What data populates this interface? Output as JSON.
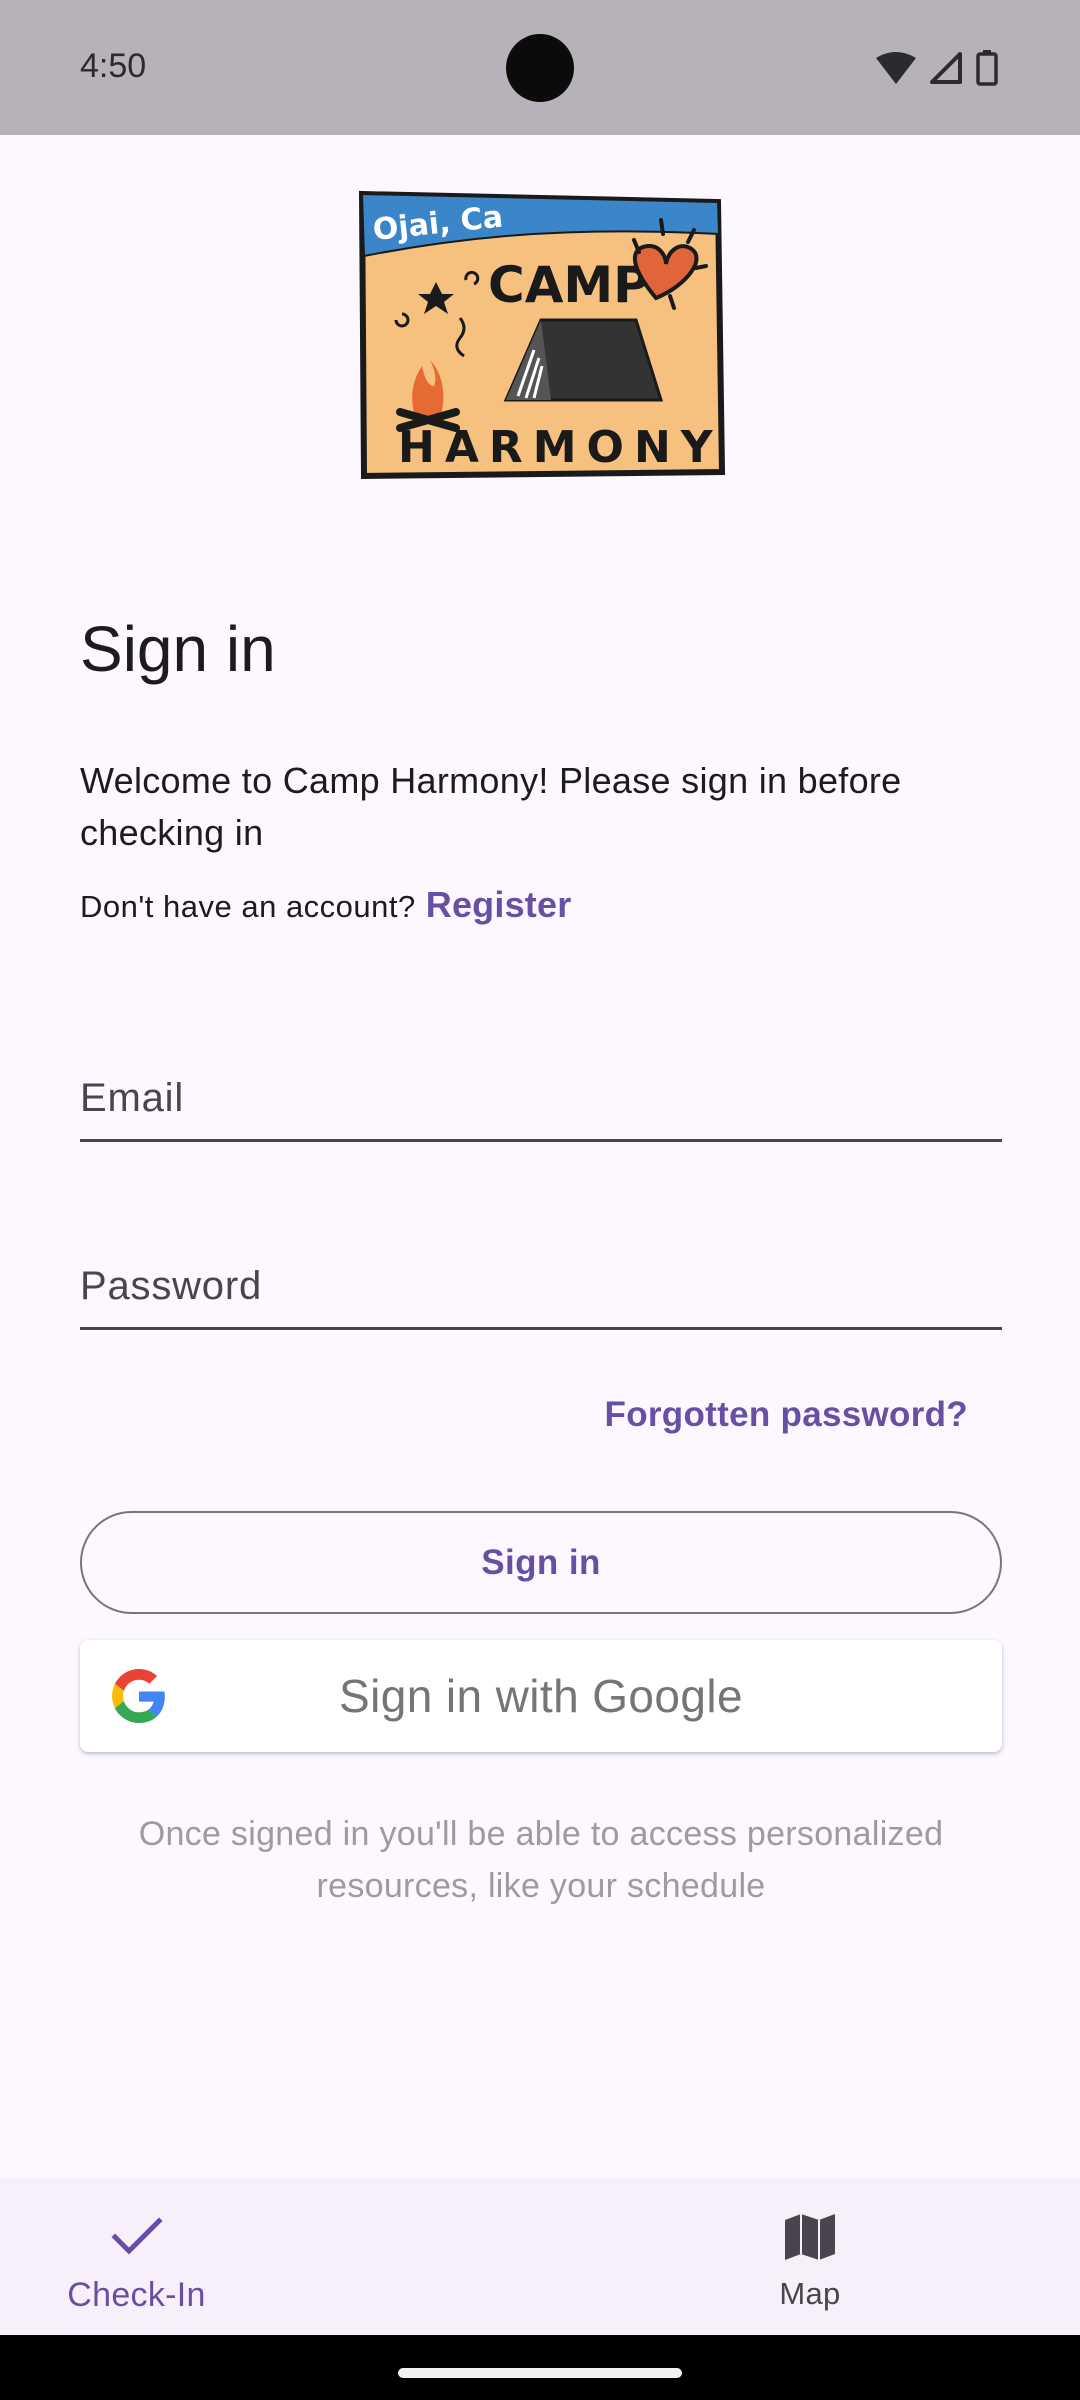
{
  "status_bar": {
    "time": "4:50",
    "icons": [
      "wifi-icon",
      "cell-signal-icon",
      "battery-icon"
    ]
  },
  "logo": {
    "text_top": "Ojai, Ca",
    "text_camp": "CAMP",
    "text_harmony": "HARMONY"
  },
  "page": {
    "title": "Sign in",
    "welcome": "Welcome to Camp Harmony! Please sign in before checking in",
    "no_account_text": "Don't have an account?",
    "register_link": "Register"
  },
  "form": {
    "email_placeholder": "Email",
    "email_value": "",
    "password_placeholder": "Password",
    "password_value": "",
    "forgot_link": "Forgotten password?",
    "signin_label": "Sign in",
    "google_label": "Sign in with Google",
    "note": "Once signed in you'll be able to access personalized resources, like your schedule"
  },
  "bottom_nav": {
    "items": [
      {
        "label": "Check-In",
        "icon": "check-icon",
        "selected": true
      },
      {
        "label": "Map",
        "icon": "map-icon",
        "selected": false
      }
    ]
  },
  "colors": {
    "primary": "#6750a4",
    "background": "#fdf7ff",
    "status_bar": "#b7b2b9",
    "on_surface": "#1c1b1f"
  }
}
